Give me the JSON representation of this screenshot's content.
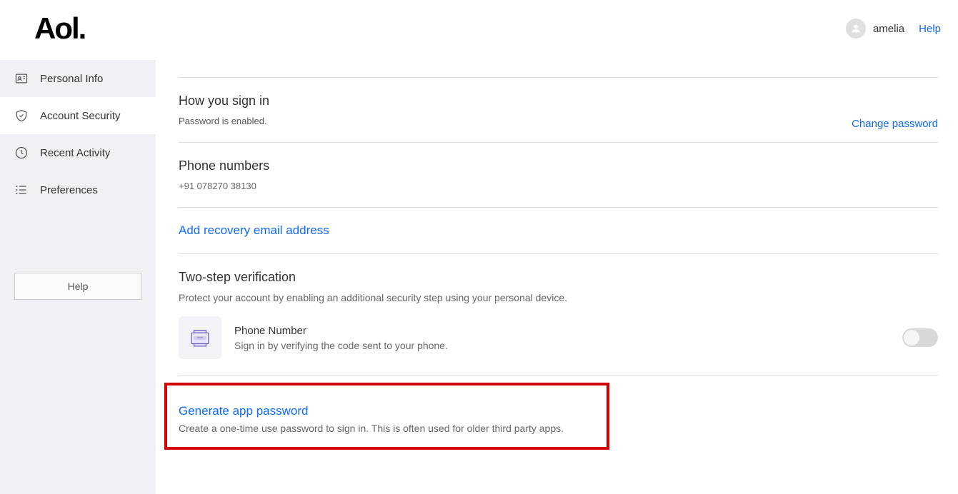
{
  "header": {
    "logo": "Aol.",
    "username": "amelia",
    "help": "Help"
  },
  "sidebar": {
    "items": [
      {
        "label": "Personal Info"
      },
      {
        "label": "Account Security"
      },
      {
        "label": "Recent Activity"
      },
      {
        "label": "Preferences"
      }
    ],
    "help_button": "Help"
  },
  "signin": {
    "title": "How you sign in",
    "status": "Password is enabled.",
    "change_link": "Change password"
  },
  "phone": {
    "title": "Phone numbers",
    "value": "+91 078270 38130"
  },
  "recovery": {
    "add_link": "Add recovery email address"
  },
  "tsv": {
    "title": "Two-step verification",
    "desc": "Protect your account by enabling an additional security step using your personal device.",
    "method_label": "Phone Number",
    "method_sub": "Sign in by verifying the code sent to your phone."
  },
  "app_password": {
    "link": "Generate app password",
    "sub": "Create a one-time use password to sign in. This is often used for older third party apps."
  }
}
